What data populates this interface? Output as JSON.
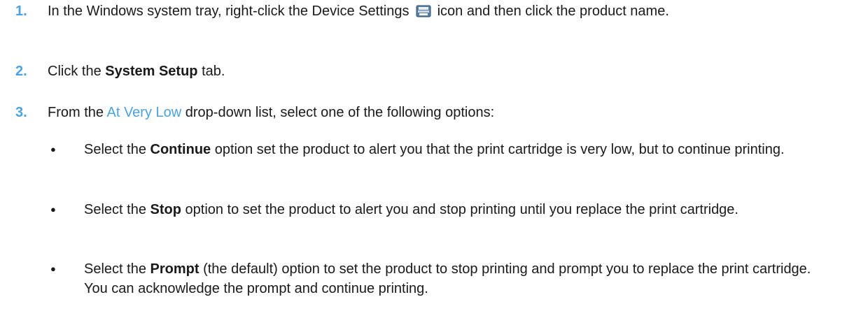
{
  "steps": [
    {
      "number": "1.",
      "text_before_icon": "In the Windows system tray, right-click the Device Settings ",
      "icon": "printer-tray-icon",
      "text_after_icon": " icon and then click the product name."
    },
    {
      "number": "2.",
      "text_before_bold": "Click the ",
      "bold": "System Setup",
      "text_after_bold": " tab."
    },
    {
      "number": "3.",
      "text_before_link": "From the ",
      "link": "At Very Low",
      "text_after_link": " drop-down list, select one of the following options:"
    }
  ],
  "options": [
    {
      "bullet": "●",
      "prefix": "Select the ",
      "bold": "Continue",
      "suffix": " option set the product to alert you that the print cartridge is very low, but to continue printing."
    },
    {
      "bullet": "●",
      "prefix": "Select the ",
      "bold": "Stop",
      "suffix": " option to set the product to alert you and stop printing until you replace the print cartridge."
    },
    {
      "bullet": "●",
      "prefix": "Select the ",
      "bold": "Prompt",
      "suffix": " (the default) option to set the product to stop printing and prompt you to replace the print cartridge. You can acknowledge the prompt and continue printing."
    }
  ],
  "colors": {
    "step_number": "#4aa3df",
    "link": "#4aa3df",
    "text": "#1a1a1a"
  }
}
